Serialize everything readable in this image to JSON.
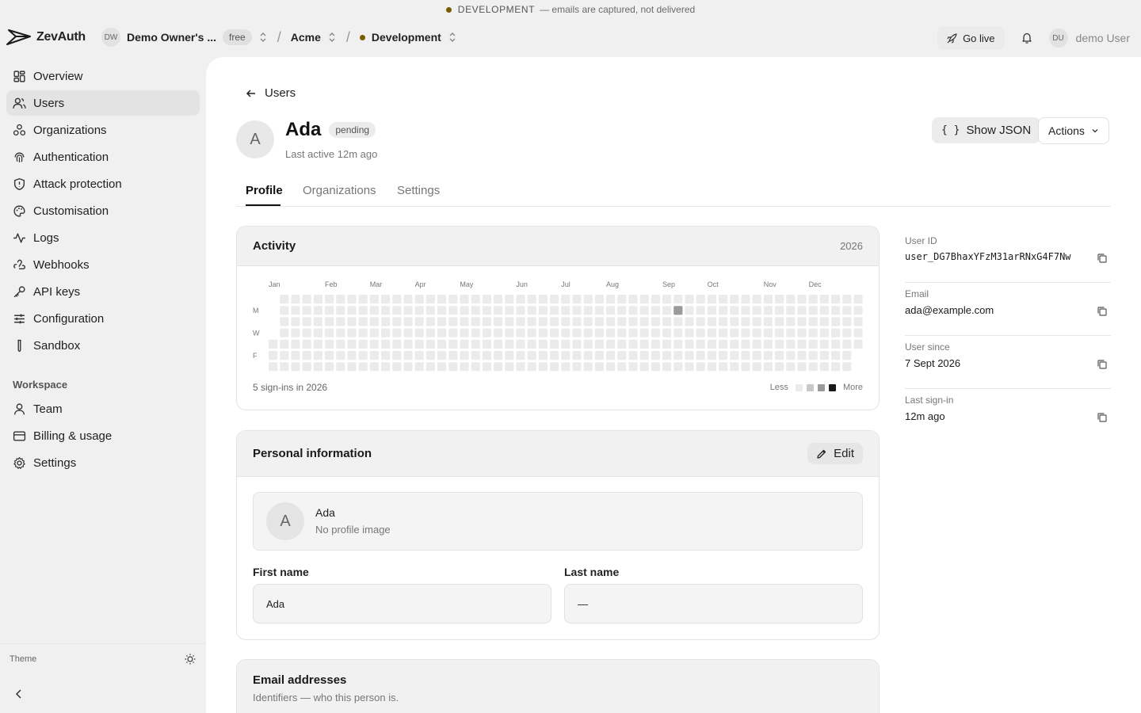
{
  "banner": {
    "env": "DEVELOPMENT",
    "note": "— emails are captured, not delivered"
  },
  "topbar": {
    "brand": "ZevAuth",
    "org_initials": "DW",
    "org_name": "Demo Owner's ...",
    "plan": "free",
    "project": "Acme",
    "environment": "Development",
    "go_live": "Go live",
    "user_initials": "DU",
    "user_name": "demo User"
  },
  "sidebar": {
    "items": [
      {
        "label": "Overview",
        "icon": "grid-icon"
      },
      {
        "label": "Users",
        "icon": "users-icon",
        "active": true
      },
      {
        "label": "Organizations",
        "icon": "organizations-icon"
      },
      {
        "label": "Authentication",
        "icon": "fingerprint-icon"
      },
      {
        "label": "Attack protection",
        "icon": "shield-icon"
      },
      {
        "label": "Customisation",
        "icon": "palette-icon"
      },
      {
        "label": "Logs",
        "icon": "activity-icon"
      },
      {
        "label": "Webhooks",
        "icon": "webhook-icon"
      },
      {
        "label": "API keys",
        "icon": "key-icon"
      },
      {
        "label": "Configuration",
        "icon": "sliders-icon"
      },
      {
        "label": "Sandbox",
        "icon": "test-tube-icon"
      }
    ],
    "workspace_label": "Workspace",
    "workspace_items": [
      {
        "label": "Team",
        "icon": "user-icon"
      },
      {
        "label": "Billing & usage",
        "icon": "credit-card-icon"
      },
      {
        "label": "Settings",
        "icon": "gear-icon"
      }
    ],
    "theme_label": "Theme"
  },
  "page": {
    "back_label": "Users",
    "avatar_initial": "A",
    "user_name": "Ada",
    "status": "pending",
    "last_active": "Last active 12m ago",
    "show_json": "Show JSON",
    "actions": "Actions",
    "tabs": [
      "Profile",
      "Organizations",
      "Settings"
    ],
    "active_tab": "Profile"
  },
  "activity": {
    "title": "Activity",
    "year": "2026",
    "months": [
      "Jan",
      "Feb",
      "Mar",
      "Apr",
      "May",
      "Jun",
      "Jul",
      "Aug",
      "Sep",
      "Oct",
      "Nov",
      "Dec"
    ],
    "day_labels": [
      "M",
      "W",
      "F"
    ],
    "summary": "5 sign-ins in 2026",
    "legend_less": "Less",
    "legend_more": "More",
    "levels": [
      "#ebebeb",
      "#c8c8c8",
      "#9a9a9a",
      "#1a1a1a"
    ],
    "highlight": {
      "date": "2026-09-07",
      "level": 2
    }
  },
  "personal": {
    "title": "Personal information",
    "edit": "Edit",
    "avatar_initial": "A",
    "display_name": "Ada",
    "image_note": "No profile image",
    "first_name_label": "First name",
    "first_name": "Ada",
    "last_name_label": "Last name",
    "last_name": "—"
  },
  "emails": {
    "title": "Email addresses",
    "subtitle": "Identifiers — who this person is."
  },
  "info": [
    {
      "label": "User ID",
      "value": "user_DG7BhaxYFzM31arRNxG4F7Nw",
      "mono": true
    },
    {
      "label": "Email",
      "value": "ada@example.com"
    },
    {
      "label": "User since",
      "value": "7 Sept 2026"
    },
    {
      "label": "Last sign-in",
      "value": "12m ago"
    }
  ]
}
